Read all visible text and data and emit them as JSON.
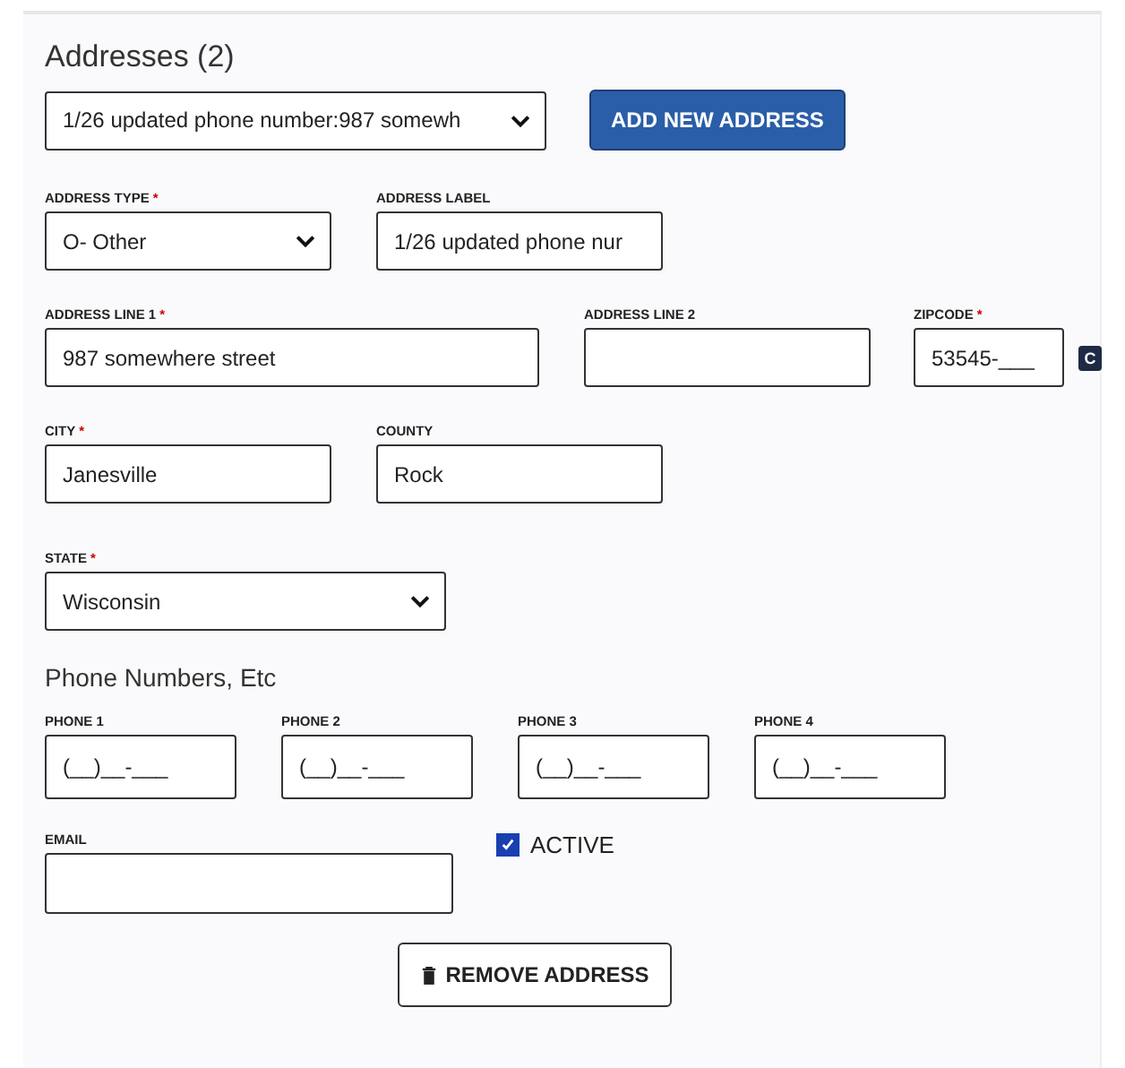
{
  "section": {
    "title": "Addresses (2)"
  },
  "address_picker": {
    "value": "1/26 updated phone number:987 somewh",
    "kind": "select"
  },
  "add_button": {
    "label": "ADD NEW ADDRESS"
  },
  "rows": [
    {
      "fields": [
        {
          "label": "ADDRESS TYPE",
          "mark": "*",
          "kind": "select",
          "value": "O- Other"
        },
        {
          "label": "ADDRESS LABEL",
          "kind": "input",
          "value": "1/26 updated phone nur"
        }
      ]
    },
    {
      "fields": [
        {
          "label": "ADDRESS LINE 1",
          "mark": "*",
          "kind": "input",
          "value": "987 somewhere street"
        },
        {
          "label": "ADDRESS LINE 2",
          "kind": "input"
        },
        {
          "label": "ZIPCODE",
          "mark": "*",
          "kind": "input",
          "value": "53545-___",
          "badge": "C"
        }
      ]
    },
    {
      "fields": [
        {
          "label": "CITY",
          "mark": "*",
          "kind": "input",
          "value": "Janesville"
        },
        {
          "label": "COUNTY",
          "kind": "input",
          "value": "Rock"
        }
      ]
    },
    {
      "fields": [
        {
          "label": "STATE",
          "mark": "*",
          "kind": "select",
          "value": "Wisconsin"
        }
      ]
    }
  ],
  "phones": {
    "title": "Phone Numbers, Etc",
    "fields": [
      {
        "label": "PHONE 1",
        "value": "(__)__-___"
      },
      {
        "label": "PHONE 2",
        "value": "(__)__-___"
      },
      {
        "label": "PHONE 3",
        "value": "(__)__-___"
      },
      {
        "label": "PHONE 4",
        "value": "(__)__-___"
      }
    ]
  },
  "email": {
    "label": "EMAIL"
  },
  "active": {
    "label": "ACTIVE",
    "checked": true
  },
  "remove_button": {
    "label": "REMOVE ADDRESS"
  }
}
